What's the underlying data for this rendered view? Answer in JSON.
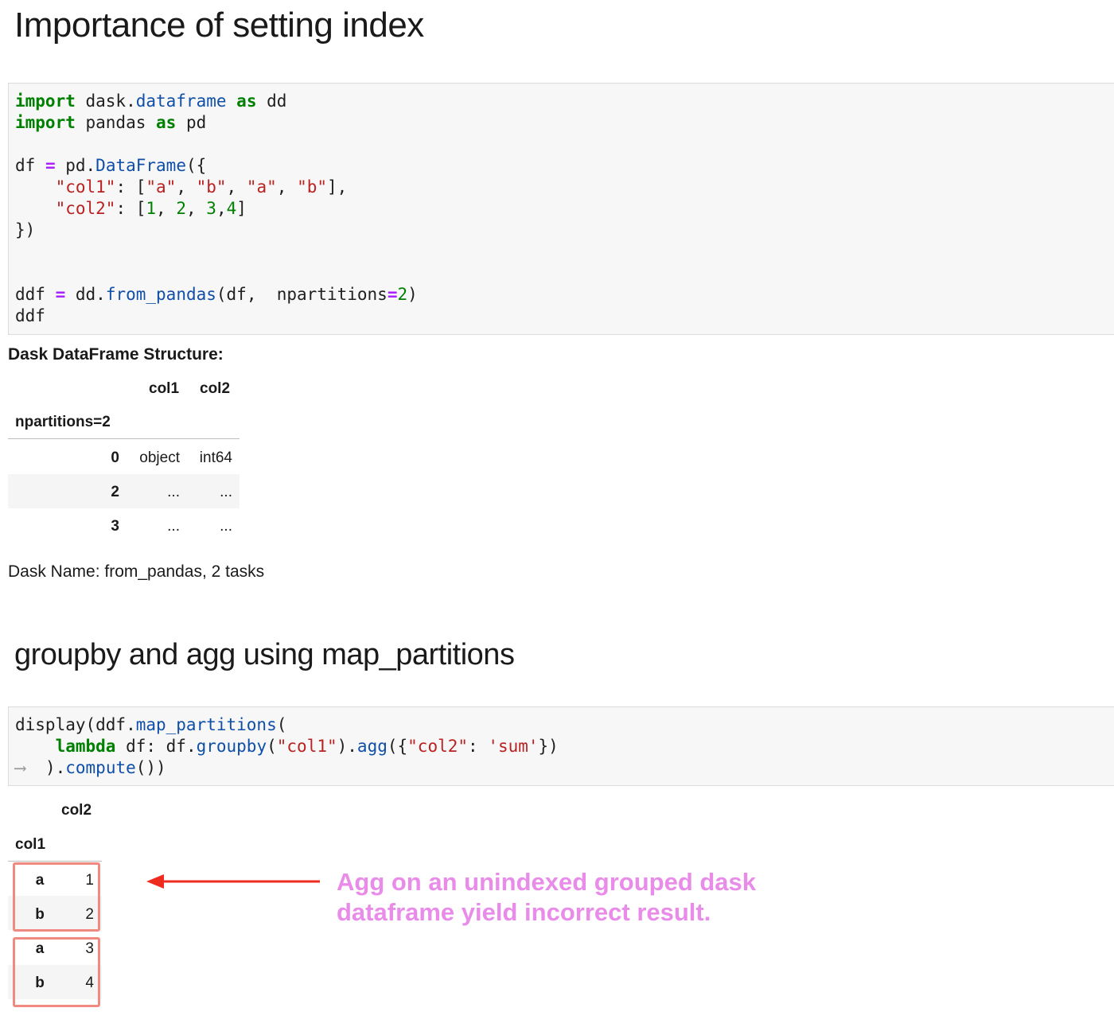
{
  "section1": {
    "heading": "Importance of setting index",
    "code": {
      "l1_kw1": "import",
      "l1_mid": " dask.",
      "l1_nm": "dataframe",
      "l1_kw2": "as",
      "l1_end": " dd",
      "l2_kw1": "import",
      "l2_mid": " pandas ",
      "l2_kw2": "as",
      "l2_end": " pd",
      "l3_a": "df ",
      "l3_op": "=",
      "l3_b": " pd.",
      "l3_nm": "DataFrame",
      "l3_c": "({",
      "l4_indent": "    ",
      "l4_key": "\"col1\"",
      "l4_a": ": [",
      "l4_s1": "\"a\"",
      "l4_s2": "\"b\"",
      "l4_s3": "\"a\"",
      "l4_s4": "\"b\"",
      "l4_end": "],",
      "l5_indent": "    ",
      "l5_key": "\"col2\"",
      "l5_a": ": [",
      "l5_n1": "1",
      "l5_n2": "2",
      "l5_n3": "3",
      "l5_n4": "4",
      "l5_end": "]",
      "l6": "})",
      "l7_a": "ddf ",
      "l7_op": "=",
      "l7_b": " dd.",
      "l7_nm": "from_pandas",
      "l7_c": "(df,  npartitions",
      "l7_op2": "=",
      "l7_num": "2",
      "l7_end": ")",
      "l8": "ddf"
    },
    "output": {
      "title": "Dask DataFrame Structure:",
      "columns": [
        "col1",
        "col2"
      ],
      "index_name": "npartitions=2",
      "rows": [
        {
          "index": "0",
          "col1": "object",
          "col2": "int64"
        },
        {
          "index": "2",
          "col1": "...",
          "col2": "..."
        },
        {
          "index": "3",
          "col1": "...",
          "col2": "..."
        }
      ],
      "dask_name": "Dask Name: from_pandas, 2 tasks"
    }
  },
  "section2": {
    "heading": "groupby and agg using map_partitions",
    "code": {
      "l1_a": "display(ddf.",
      "l1_nm": "map_partitions",
      "l1_b": "(",
      "l2_indent": "    ",
      "l2_kw": "lambda",
      "l2_a": " df: df.",
      "l2_nm1": "groupby",
      "l2_b": "(",
      "l2_s1": "\"col1\"",
      "l2_c": ").",
      "l2_nm2": "agg",
      "l2_d": "({",
      "l2_s2": "\"col2\"",
      "l2_e": ": ",
      "l2_s3": "'sum'",
      "l2_f": "})",
      "l3_arrow": "⟶",
      "l3_a": ").",
      "l3_nm": "compute",
      "l3_b": "())"
    },
    "output": {
      "column": "col2",
      "index_name": "col1",
      "rows": [
        {
          "index": "a",
          "col2": "1"
        },
        {
          "index": "b",
          "col2": "2"
        },
        {
          "index": "a",
          "col2": "3"
        },
        {
          "index": "b",
          "col2": "4"
        }
      ]
    },
    "annotation": {
      "line1": "Agg on an unindexed grouped dask",
      "line2": "dataframe yield incorrect result.",
      "color": "#e98be9",
      "arrow_color": "#ee2b1f",
      "box_color": "#f08a80"
    }
  }
}
